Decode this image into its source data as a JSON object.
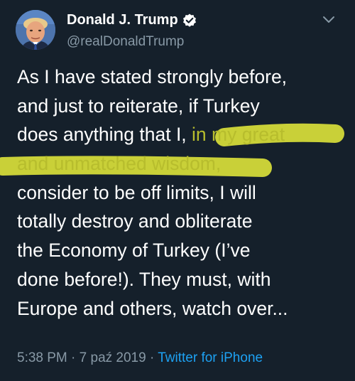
{
  "tweet": {
    "author": {
      "display_name": "Donald J. Trump",
      "handle": "@realDonaldTrump",
      "verified": true
    },
    "body_lines": [
      {
        "before": "As I have stated strongly before,",
        "highlight": "",
        "after": ""
      },
      {
        "before": "and just to reiterate, if Turkey",
        "highlight": "",
        "after": ""
      },
      {
        "before": "does anything that I, ",
        "highlight": "in my great",
        "after": ""
      },
      {
        "before": "",
        "highlight": "and unmatched wisdom,",
        "after": ""
      },
      {
        "before": "consider to be off limits, I will",
        "highlight": "",
        "after": ""
      },
      {
        "before": "totally destroy and obliterate",
        "highlight": "",
        "after": ""
      },
      {
        "before": "the Economy of Turkey (I’ve",
        "highlight": "",
        "after": ""
      },
      {
        "before": "done before!). They must, with",
        "highlight": "",
        "after": ""
      },
      {
        "before": "Europe and others, watch over...",
        "highlight": "",
        "after": ""
      }
    ],
    "meta": {
      "time": "5:38 PM",
      "separator": "·",
      "date": "7 paź 2019",
      "source": "Twitter for iPhone"
    }
  },
  "colors": {
    "background": "#15202b",
    "text": "#ffffff",
    "secondary_text": "#8899a6",
    "link": "#1da1f2",
    "highlighter": "#d9df3a"
  },
  "icons": {
    "verified": "verified-badge-icon",
    "menu": "chevron-down-icon"
  }
}
